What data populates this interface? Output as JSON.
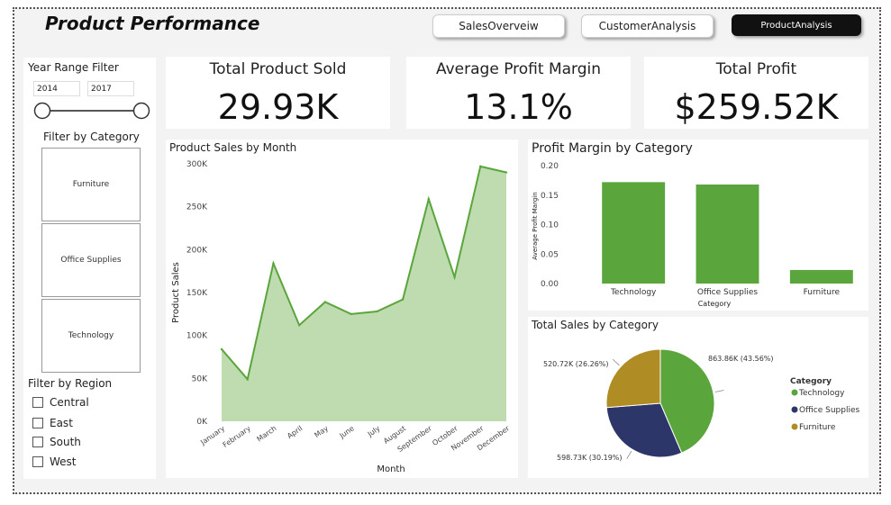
{
  "page_title": "Product Performance",
  "nav": {
    "tabs": [
      {
        "label": "SalesOverveiw"
      },
      {
        "label": "CustomerAnalysis"
      },
      {
        "label": "ProductAnalysis"
      }
    ]
  },
  "filters": {
    "year_title": "Year Range Filter",
    "year_start": "2014",
    "year_end": "2017",
    "category_title": "Filter by Category",
    "categories": [
      "Furniture",
      "Office Supplies",
      "Technology"
    ],
    "region_title": "Filter by Region",
    "regions": [
      "Central",
      "East",
      "South",
      "West"
    ]
  },
  "kpis": [
    {
      "label": "Total Product Sold",
      "value": "29.93K"
    },
    {
      "label": "Average Profit Margin",
      "value": "13.1%"
    },
    {
      "label": "Total Profit",
      "value": "$259.52K"
    }
  ],
  "colors": {
    "accent": "#5aa53c",
    "area_fill": "#bfdcb0",
    "navy": "#2d3668",
    "gold": "#b08c24"
  },
  "chart_data": [
    {
      "type": "area",
      "title": "Product Sales by Month",
      "xlabel": "Month",
      "ylabel": "Product Sales",
      "categories": [
        "January",
        "February",
        "March",
        "April",
        "May",
        "June",
        "July",
        "August",
        "September",
        "October",
        "November",
        "December"
      ],
      "values": [
        84000,
        49000,
        184000,
        112000,
        139000,
        125000,
        128000,
        142000,
        259000,
        168000,
        297000,
        290000
      ],
      "ylim": [
        0,
        300000
      ],
      "yticks": [
        "0K",
        "50K",
        "100K",
        "150K",
        "200K",
        "250K",
        "300K"
      ]
    },
    {
      "type": "bar",
      "title": "Profit Margin by Category",
      "xlabel": "Category",
      "ylabel": "Average Profit Margin",
      "categories": [
        "Technology",
        "Office Supplies",
        "Furniture"
      ],
      "values": [
        0.172,
        0.168,
        0.023
      ],
      "ylim": [
        0,
        0.2
      ],
      "yticks": [
        "0.00",
        "0.05",
        "0.10",
        "0.15",
        "0.20"
      ]
    },
    {
      "type": "pie",
      "title": "Total Sales by Category",
      "legend_title": "Category",
      "slices": [
        {
          "name": "Technology",
          "value": 863.86,
          "label": "863.86K (43.56%)"
        },
        {
          "name": "Office Supplies",
          "value": 598.73,
          "label": "598.73K (30.19%)"
        },
        {
          "name": "Furniture",
          "value": 520.72,
          "label": "520.72K (26.26%)"
        }
      ]
    }
  ]
}
